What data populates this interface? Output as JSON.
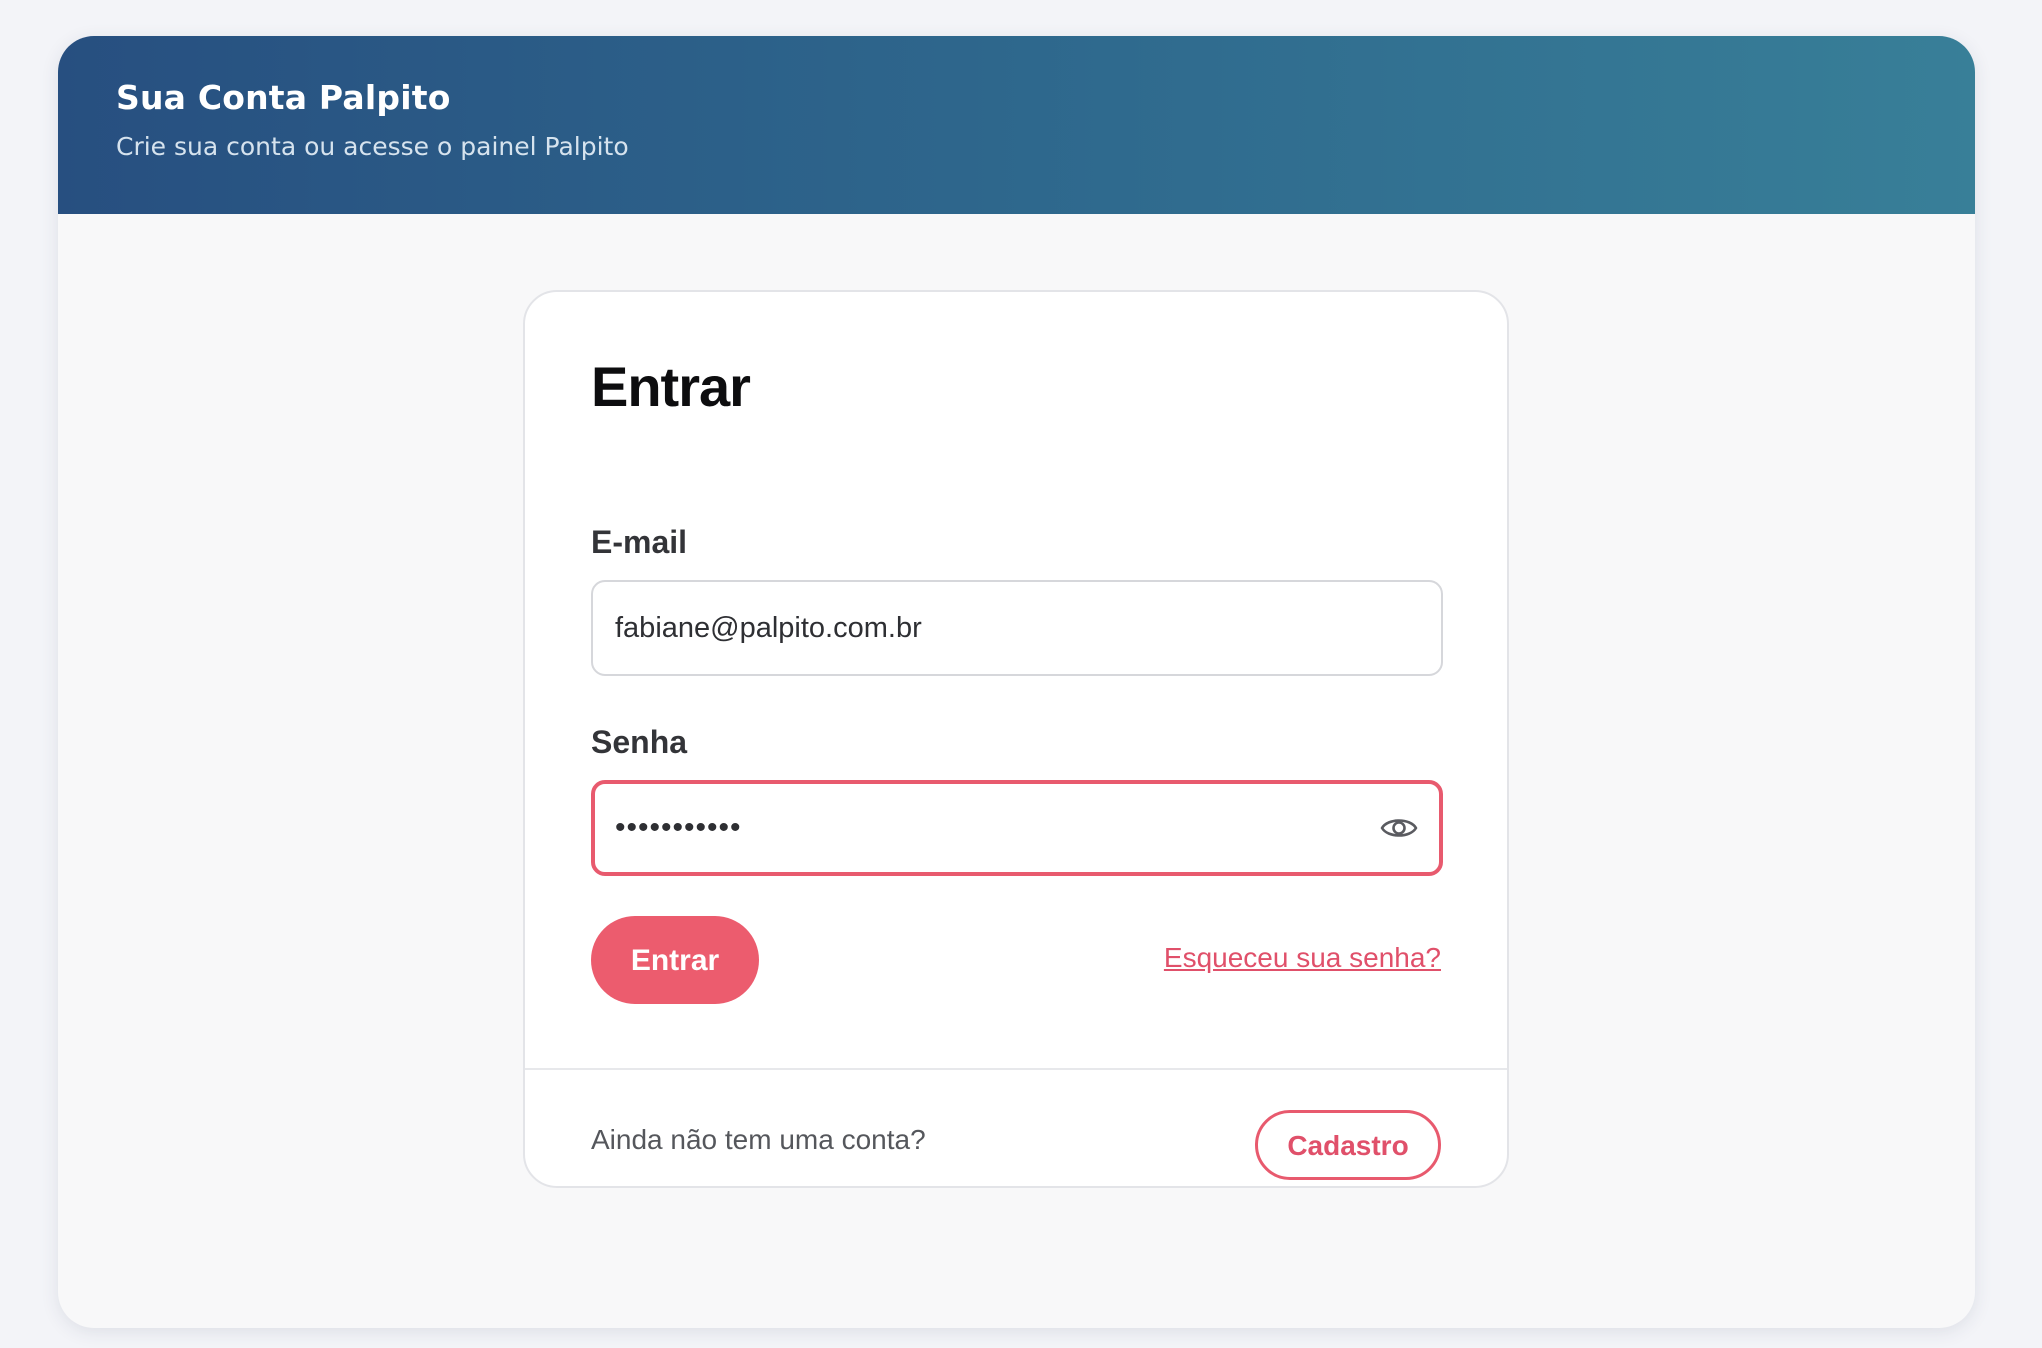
{
  "header": {
    "title": "Sua Conta Palpito",
    "subtitle": "Crie sua conta ou acesse o painel Palpito"
  },
  "login": {
    "title": "Entrar",
    "email": {
      "label": "E-mail",
      "value": "fabiane@palpito.com.br"
    },
    "password": {
      "label": "Senha",
      "value": "•••••••••••",
      "toggle_icon": "eye-icon"
    },
    "submit_label": "Entrar",
    "forgot_label": "Esqueceu sua senha?"
  },
  "footer": {
    "prompt": "Ainda não tem uma conta?",
    "signup_label": "Cadastro"
  },
  "colors": {
    "accent": "#ec5c6e",
    "header_start": "#274f80",
    "header_end": "#387f98"
  }
}
